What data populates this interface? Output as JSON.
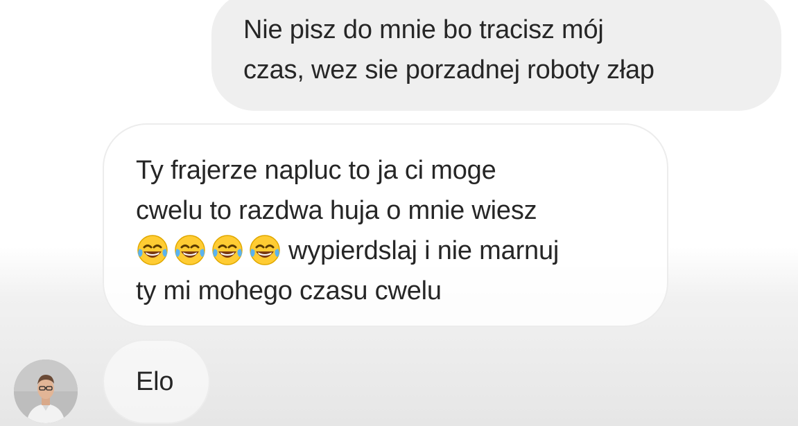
{
  "conversation": {
    "messages": [
      {
        "direction": "sent",
        "lines": [
          "Nie pisz do mnie bo tracisz mój",
          "czas, wez sie porzadnej roboty złap"
        ]
      },
      {
        "direction": "received",
        "lines": [
          "Ty frajerze napluc to ja ci moge",
          "cwelu to razdwa huja o mnie wiesz",
          "wypierdslaj i nie marnuj",
          "ty mi mohego czasu cwelu"
        ],
        "emojis": [
          "tears-of-joy-emoji",
          "tears-of-joy-emoji",
          "tears-of-joy-emoji",
          "tears-of-joy-emoji"
        ]
      },
      {
        "direction": "received",
        "lines": [
          "Elo"
        ]
      }
    ],
    "sender_avatar": "person-photo-avatar"
  },
  "colors": {
    "sent_bubble": "#efefef",
    "received_bubble_border": "#ececec",
    "text": "#262626",
    "emoji_face": "#ffcc33"
  }
}
